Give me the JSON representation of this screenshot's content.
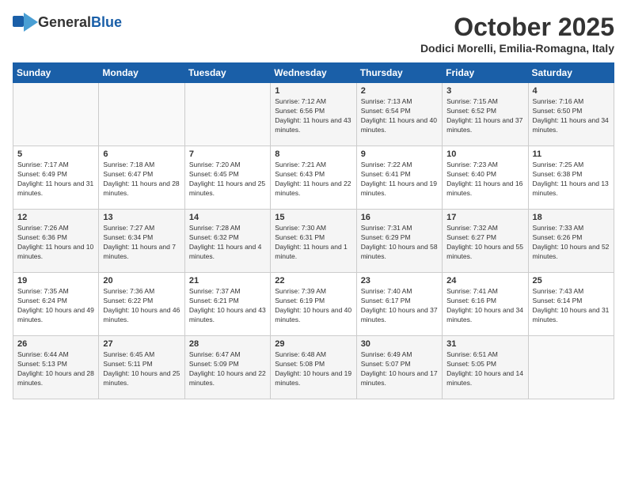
{
  "logo": {
    "general": "General",
    "blue": "Blue"
  },
  "title": "October 2025",
  "location": "Dodici Morelli, Emilia-Romagna, Italy",
  "days_of_week": [
    "Sunday",
    "Monday",
    "Tuesday",
    "Wednesday",
    "Thursday",
    "Friday",
    "Saturday"
  ],
  "weeks": [
    [
      {
        "day": "",
        "info": ""
      },
      {
        "day": "",
        "info": ""
      },
      {
        "day": "",
        "info": ""
      },
      {
        "day": "1",
        "info": "Sunrise: 7:12 AM\nSunset: 6:56 PM\nDaylight: 11 hours and 43 minutes."
      },
      {
        "day": "2",
        "info": "Sunrise: 7:13 AM\nSunset: 6:54 PM\nDaylight: 11 hours and 40 minutes."
      },
      {
        "day": "3",
        "info": "Sunrise: 7:15 AM\nSunset: 6:52 PM\nDaylight: 11 hours and 37 minutes."
      },
      {
        "day": "4",
        "info": "Sunrise: 7:16 AM\nSunset: 6:50 PM\nDaylight: 11 hours and 34 minutes."
      }
    ],
    [
      {
        "day": "5",
        "info": "Sunrise: 7:17 AM\nSunset: 6:49 PM\nDaylight: 11 hours and 31 minutes."
      },
      {
        "day": "6",
        "info": "Sunrise: 7:18 AM\nSunset: 6:47 PM\nDaylight: 11 hours and 28 minutes."
      },
      {
        "day": "7",
        "info": "Sunrise: 7:20 AM\nSunset: 6:45 PM\nDaylight: 11 hours and 25 minutes."
      },
      {
        "day": "8",
        "info": "Sunrise: 7:21 AM\nSunset: 6:43 PM\nDaylight: 11 hours and 22 minutes."
      },
      {
        "day": "9",
        "info": "Sunrise: 7:22 AM\nSunset: 6:41 PM\nDaylight: 11 hours and 19 minutes."
      },
      {
        "day": "10",
        "info": "Sunrise: 7:23 AM\nSunset: 6:40 PM\nDaylight: 11 hours and 16 minutes."
      },
      {
        "day": "11",
        "info": "Sunrise: 7:25 AM\nSunset: 6:38 PM\nDaylight: 11 hours and 13 minutes."
      }
    ],
    [
      {
        "day": "12",
        "info": "Sunrise: 7:26 AM\nSunset: 6:36 PM\nDaylight: 11 hours and 10 minutes."
      },
      {
        "day": "13",
        "info": "Sunrise: 7:27 AM\nSunset: 6:34 PM\nDaylight: 11 hours and 7 minutes."
      },
      {
        "day": "14",
        "info": "Sunrise: 7:28 AM\nSunset: 6:32 PM\nDaylight: 11 hours and 4 minutes."
      },
      {
        "day": "15",
        "info": "Sunrise: 7:30 AM\nSunset: 6:31 PM\nDaylight: 11 hours and 1 minute."
      },
      {
        "day": "16",
        "info": "Sunrise: 7:31 AM\nSunset: 6:29 PM\nDaylight: 10 hours and 58 minutes."
      },
      {
        "day": "17",
        "info": "Sunrise: 7:32 AM\nSunset: 6:27 PM\nDaylight: 10 hours and 55 minutes."
      },
      {
        "day": "18",
        "info": "Sunrise: 7:33 AM\nSunset: 6:26 PM\nDaylight: 10 hours and 52 minutes."
      }
    ],
    [
      {
        "day": "19",
        "info": "Sunrise: 7:35 AM\nSunset: 6:24 PM\nDaylight: 10 hours and 49 minutes."
      },
      {
        "day": "20",
        "info": "Sunrise: 7:36 AM\nSunset: 6:22 PM\nDaylight: 10 hours and 46 minutes."
      },
      {
        "day": "21",
        "info": "Sunrise: 7:37 AM\nSunset: 6:21 PM\nDaylight: 10 hours and 43 minutes."
      },
      {
        "day": "22",
        "info": "Sunrise: 7:39 AM\nSunset: 6:19 PM\nDaylight: 10 hours and 40 minutes."
      },
      {
        "day": "23",
        "info": "Sunrise: 7:40 AM\nSunset: 6:17 PM\nDaylight: 10 hours and 37 minutes."
      },
      {
        "day": "24",
        "info": "Sunrise: 7:41 AM\nSunset: 6:16 PM\nDaylight: 10 hours and 34 minutes."
      },
      {
        "day": "25",
        "info": "Sunrise: 7:43 AM\nSunset: 6:14 PM\nDaylight: 10 hours and 31 minutes."
      }
    ],
    [
      {
        "day": "26",
        "info": "Sunrise: 6:44 AM\nSunset: 5:13 PM\nDaylight: 10 hours and 28 minutes."
      },
      {
        "day": "27",
        "info": "Sunrise: 6:45 AM\nSunset: 5:11 PM\nDaylight: 10 hours and 25 minutes."
      },
      {
        "day": "28",
        "info": "Sunrise: 6:47 AM\nSunset: 5:09 PM\nDaylight: 10 hours and 22 minutes."
      },
      {
        "day": "29",
        "info": "Sunrise: 6:48 AM\nSunset: 5:08 PM\nDaylight: 10 hours and 19 minutes."
      },
      {
        "day": "30",
        "info": "Sunrise: 6:49 AM\nSunset: 5:07 PM\nDaylight: 10 hours and 17 minutes."
      },
      {
        "day": "31",
        "info": "Sunrise: 6:51 AM\nSunset: 5:05 PM\nDaylight: 10 hours and 14 minutes."
      },
      {
        "day": "",
        "info": ""
      }
    ]
  ]
}
